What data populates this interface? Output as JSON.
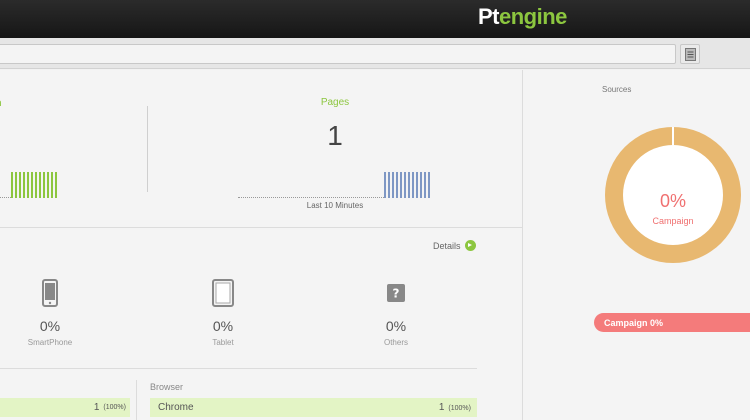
{
  "header": {
    "logo_pt": "Pt",
    "logo_engine": "engine"
  },
  "overview": {
    "pages_title": "Pages",
    "pages_value": "1",
    "bars_caption": "Last 10 Minutes"
  },
  "devices": {
    "details_label": "Details",
    "items": [
      {
        "icon": "smartphone-icon",
        "percent": "0%",
        "name": "SmartPhone"
      },
      {
        "icon": "tablet-icon",
        "percent": "0%",
        "name": "Tablet"
      },
      {
        "icon": "question-icon",
        "percent": "0%",
        "name": "Others"
      }
    ]
  },
  "left_stat": {
    "value": "1",
    "percent": "(100%)"
  },
  "browser": {
    "title": "Browser",
    "rows": [
      {
        "name": "Chrome",
        "value": "1",
        "percent": "(100%)"
      }
    ]
  },
  "sources": {
    "title": "Sources",
    "donut_percent": "0%",
    "donut_label": "Campaign",
    "legend_label": "Campaign 0%"
  },
  "colors": {
    "accent_green": "#8cc63f",
    "bar_blue": "#7e97c4",
    "donut_orange": "#e8b870",
    "campaign_red": "#f47b7b"
  }
}
